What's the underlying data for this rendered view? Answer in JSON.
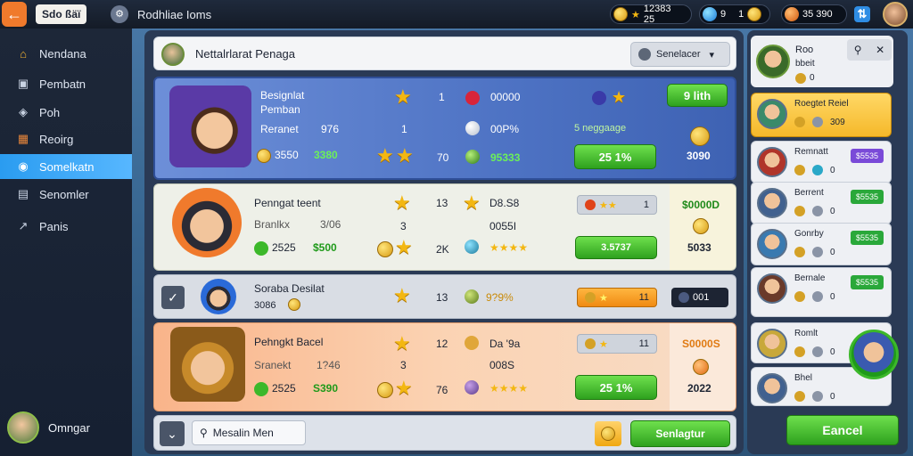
{
  "topbar": {
    "back_icon": "arrow-left-icon",
    "tag": "Sdo ßäï",
    "title": "Rodhliae Ioms",
    "currency": [
      {
        "icon": "coin-icon",
        "value": "12383 25"
      },
      {
        "icon": "gem-icon",
        "value": "9"
      },
      {
        "icon": "coin-icon",
        "value": "1"
      },
      {
        "icon": "orb-icon",
        "value": "35 390"
      }
    ]
  },
  "sidebar": {
    "items": [
      {
        "label": "Nendana",
        "icon": "home-icon"
      },
      {
        "label": "Pembatn",
        "icon": "card-icon"
      },
      {
        "label": "Poh",
        "icon": "shield-icon"
      },
      {
        "label": "Reoirg",
        "icon": "chest-icon"
      },
      {
        "label": "Somelkatn",
        "icon": "target-icon"
      },
      {
        "label": "Senomler",
        "icon": "book-icon"
      },
      {
        "label": "Panis",
        "icon": "trend-icon"
      }
    ],
    "active_index": 4,
    "user": {
      "name": "Omngar"
    }
  },
  "main": {
    "header": {
      "title": "Nettalrlarat Penaga",
      "select_label": "Senelacer"
    },
    "rows": [
      {
        "name_line1": "Besignlat",
        "name_line2": "Pemban",
        "sub_label": "Reranet",
        "sub_value": "976",
        "coins": "3550",
        "cash": "3380",
        "col1_top": "1",
        "col1_mid": "1",
        "col1_bot": "70",
        "stat1": "00000",
        "stat2": "00P%",
        "stat3": "95333",
        "tier_label": "5 neggaage",
        "action": "25 1%",
        "claim_label": "9 lith",
        "reward": "3090"
      },
      {
        "name_line1": "Penngat teent",
        "sub_label": "Branlkx",
        "sub_value": "3/06",
        "coins": "2525",
        "cash": "$500",
        "col1_top": "13",
        "col1_mid": "3",
        "col1_bot": "2K",
        "stat1": "D8.S8",
        "stat2": "0055I",
        "chip_value": "1",
        "action": "3.5737",
        "reward_top": "$0000D",
        "reward": "5033"
      },
      {
        "name_line1": "Soraba Desilat",
        "sub_value": "3086",
        "col1_top": "13",
        "stat1": "9?9%",
        "chip_value": "11",
        "chip2": "001"
      },
      {
        "name_line1": "Pehngkt Bacel",
        "sub_label": "Sranekt",
        "sub_value": "1?46",
        "coins": "2525",
        "cash": "S390",
        "col1_top": "12",
        "col1_mid": "3",
        "col1_bot": "76",
        "stat1": "Da '9a",
        "stat2": "008S",
        "chip_value": "11",
        "action": "25 1%",
        "reward_top": "S0000S",
        "reward": "2022"
      }
    ],
    "footer": {
      "search_placeholder": "Mesalin Men",
      "confirm_label": "Senlagtur"
    }
  },
  "right_panel": {
    "header": {
      "name": "Roo",
      "sub": "bbeit",
      "value": "0"
    },
    "items": [
      {
        "name": "Roegtet Reiel",
        "value": "309",
        "tag": "",
        "highlight": true
      },
      {
        "name": "Remnatt",
        "value": "0",
        "tag": "$5535",
        "tag_color": "#7a4ad8"
      },
      {
        "name": "Berrent",
        "value": "0",
        "tag": "$5535",
        "tag_color": "#2aa83a"
      },
      {
        "name": "Gonrby",
        "value": "0",
        "tag": "$5535",
        "tag_color": "#2aa83a"
      },
      {
        "name": "Bernale",
        "value": "0",
        "tag": "$5535",
        "tag_color": "#2aa83a"
      },
      {
        "name": "Romlt",
        "value": "0",
        "tag": ""
      },
      {
        "name": "Bhel",
        "value": "0",
        "tag": ""
      }
    ],
    "cancel_label": "Eancel"
  },
  "colors": {
    "accent": "#2a9cf0",
    "green": "#3cb82a",
    "gold": "#f3b712"
  }
}
